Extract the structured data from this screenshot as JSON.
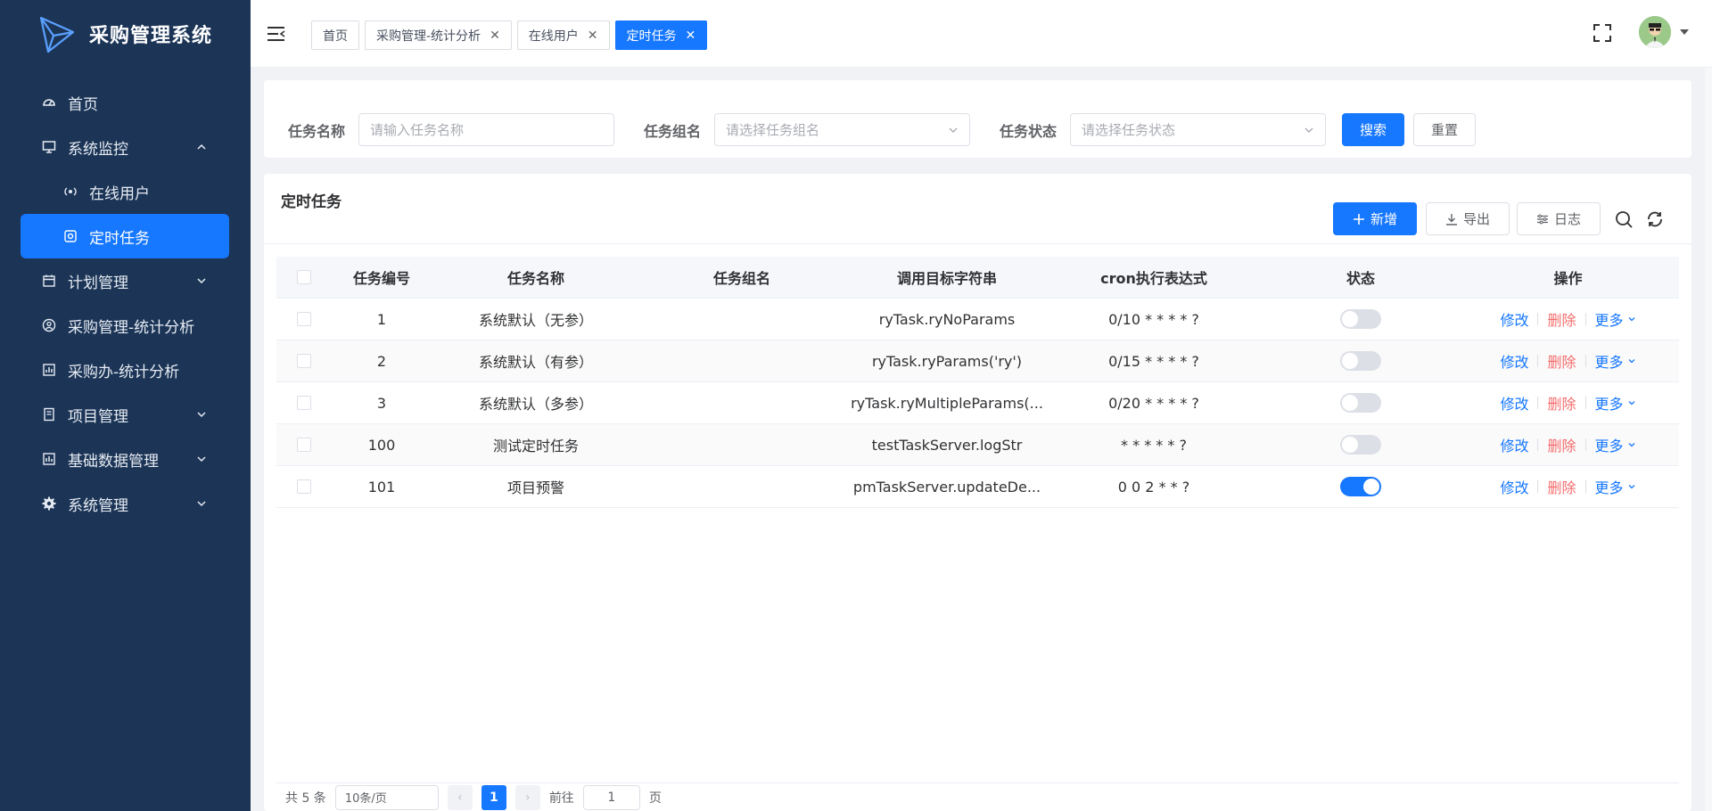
{
  "app": {
    "title": "采购管理系统"
  },
  "sidebar": {
    "items": [
      {
        "label": "首页",
        "icon": "dashboard-icon"
      },
      {
        "label": "系统监控",
        "icon": "monitor-icon",
        "expanded": true,
        "children": [
          {
            "label": "在线用户",
            "icon": "online-icon"
          },
          {
            "label": "定时任务",
            "icon": "job-icon",
            "active": true
          }
        ]
      },
      {
        "label": "计划管理",
        "icon": "calendar-icon"
      },
      {
        "label": "采购管理-统计分析",
        "icon": "user-circle-icon"
      },
      {
        "label": "采购办-统计分析",
        "icon": "chart-icon"
      },
      {
        "label": "项目管理",
        "icon": "project-icon"
      },
      {
        "label": "基础数据管理",
        "icon": "data-icon"
      },
      {
        "label": "系统管理",
        "icon": "settings-icon"
      }
    ]
  },
  "tabs": [
    {
      "label": "首页",
      "closable": false,
      "active": false
    },
    {
      "label": "采购管理-统计分析",
      "closable": true,
      "active": false
    },
    {
      "label": "在线用户",
      "closable": true,
      "active": false
    },
    {
      "label": "定时任务",
      "closable": true,
      "active": true
    }
  ],
  "search": {
    "job_name_label": "任务名称",
    "job_name_placeholder": "请输入任务名称",
    "job_group_label": "任务组名",
    "job_group_placeholder": "请选择任务组名",
    "status_label": "任务状态",
    "status_placeholder": "请选择任务状态",
    "search_btn": "搜索",
    "reset_btn": "重置"
  },
  "main": {
    "title": "定时任务",
    "add_btn": "新增",
    "export_btn": "导出",
    "log_btn": "日志"
  },
  "table": {
    "headers": [
      "任务编号",
      "任务名称",
      "任务组名",
      "调用目标字符串",
      "cron执行表达式",
      "状态",
      "操作"
    ],
    "rows": [
      {
        "id": "1",
        "name": "系统默认（无参）",
        "group": "",
        "target": "ryTask.ryNoParams",
        "cron": "0/10 * * * * ?",
        "enabled": false
      },
      {
        "id": "2",
        "name": "系统默认（有参）",
        "group": "",
        "target": "ryTask.ryParams('ry')",
        "cron": "0/15 * * * * ?",
        "enabled": false
      },
      {
        "id": "3",
        "name": "系统默认（多参）",
        "group": "",
        "target": "ryTask.ryMultipleParams(...",
        "cron": "0/20 * * * * ?",
        "enabled": false
      },
      {
        "id": "100",
        "name": "测试定时任务",
        "group": "",
        "target": "testTaskServer.logStr",
        "cron": "* * * * * ?",
        "enabled": false
      },
      {
        "id": "101",
        "name": "项目预警",
        "group": "",
        "target": "pmTaskServer.updateDe...",
        "cron": "0 0 2 * * ?",
        "enabled": true
      }
    ],
    "ops": {
      "edit": "修改",
      "delete": "删除",
      "more": "更多"
    }
  },
  "pagination": {
    "total_text": "共 5 条",
    "page_size": "10条/页",
    "current_page": "1",
    "goto_label": "前往",
    "goto_value": "1",
    "page_unit": "页"
  },
  "colors": {
    "sidebar_bg": "#1c3557",
    "primary": "#1677ff",
    "danger": "#f56c6c"
  }
}
